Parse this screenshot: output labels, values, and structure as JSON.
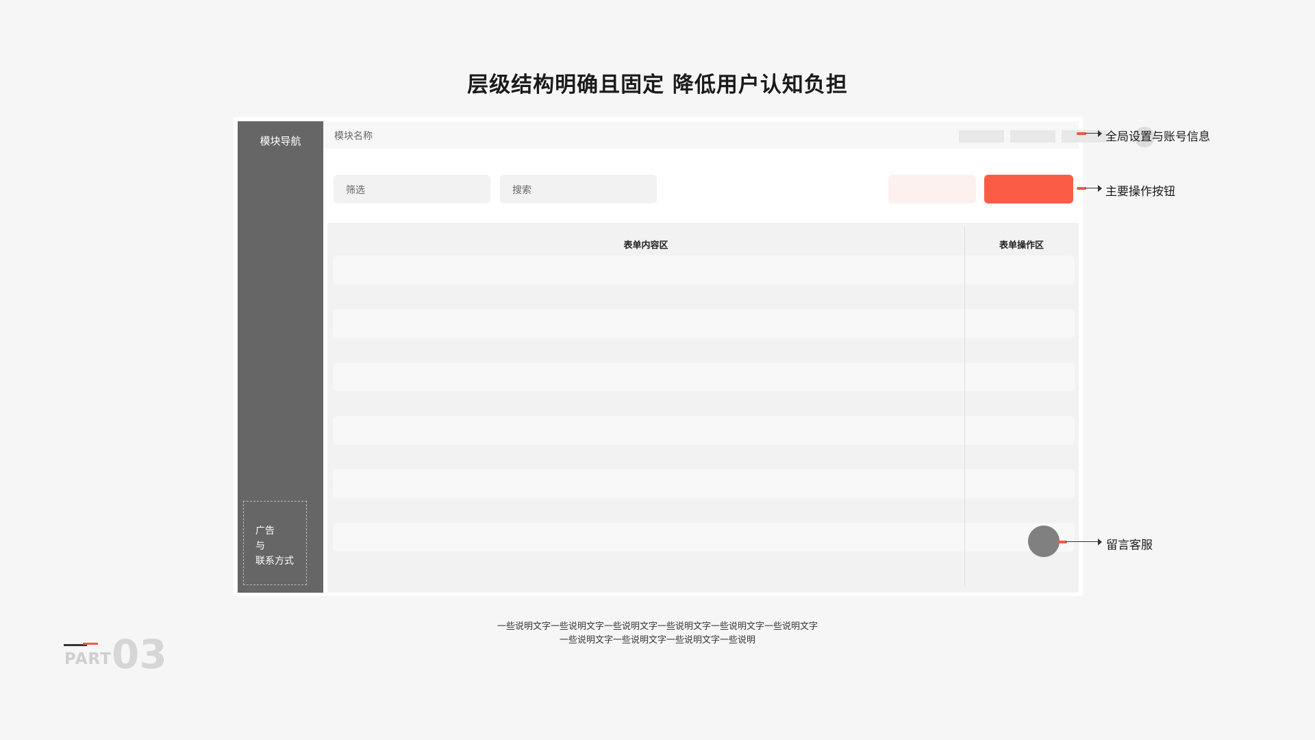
{
  "title": "层级结构明确且固定 降低用户认知负担",
  "sidebar": {
    "title": "模块导航",
    "ad_lines": [
      "广告",
      "与",
      "联系方式"
    ]
  },
  "header": {
    "module_name": "模块名称"
  },
  "toolbar": {
    "filter_placeholder": "筛选",
    "search_placeholder": "搜索"
  },
  "table": {
    "content_header": "表单内容区",
    "action_header": "表单操作区",
    "row_count": 6
  },
  "annotations": {
    "global_settings": "全局设置与账号信息",
    "primary_button": "主要操作按钮",
    "customer_service": "留言客服"
  },
  "caption": {
    "line1": "一些说明文字一些说明文字一些说明文字一些说明文字一些说明文字一些说明文字",
    "line2": "一些说明文字一些说明文字一些说明文字一些说明"
  },
  "part": {
    "label": "PART",
    "number": "03"
  },
  "colors": {
    "accent": "#fb5c45",
    "accent_light": "#fdf1f0",
    "sidebar": "#666666"
  }
}
